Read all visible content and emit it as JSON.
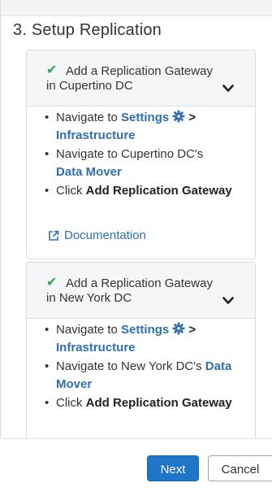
{
  "section": {
    "title": "3. Setup Replication"
  },
  "cards": [
    {
      "header_line1": "Add a Replication Gateway",
      "header_line2": "in Cupertino DC",
      "steps": [
        {
          "pre": "Navigate to ",
          "link": "Settings",
          "after_icon": " >",
          "link2": "Infrastructure"
        },
        {
          "pre": "Navigate to Cupertino DC's ",
          "link": "Data Mover"
        },
        {
          "pre": "Click ",
          "bold": "Add Replication Gateway"
        }
      ],
      "doc_link": "Documentation"
    },
    {
      "header_line1": "Add a Replication Gateway",
      "header_line2": "in New York DC",
      "steps": [
        {
          "pre": "Navigate to ",
          "link": "Settings",
          "after_icon": " >",
          "link2": "Infrastructure"
        },
        {
          "pre": "Navigate to New York DC's ",
          "link": "Data",
          "link_cont": "Mover"
        },
        {
          "pre": "Click ",
          "bold": "Add Replication Gateway"
        }
      ]
    }
  ],
  "footer": {
    "next_label": "Next",
    "cancel_label": "Cancel"
  },
  "colors": {
    "accent": "#1f75c7",
    "link": "#2f6fb0",
    "check": "#2ea44f"
  },
  "icons": [
    "check-icon",
    "chevron-down-icon",
    "gear-icon",
    "external-link-icon"
  ]
}
